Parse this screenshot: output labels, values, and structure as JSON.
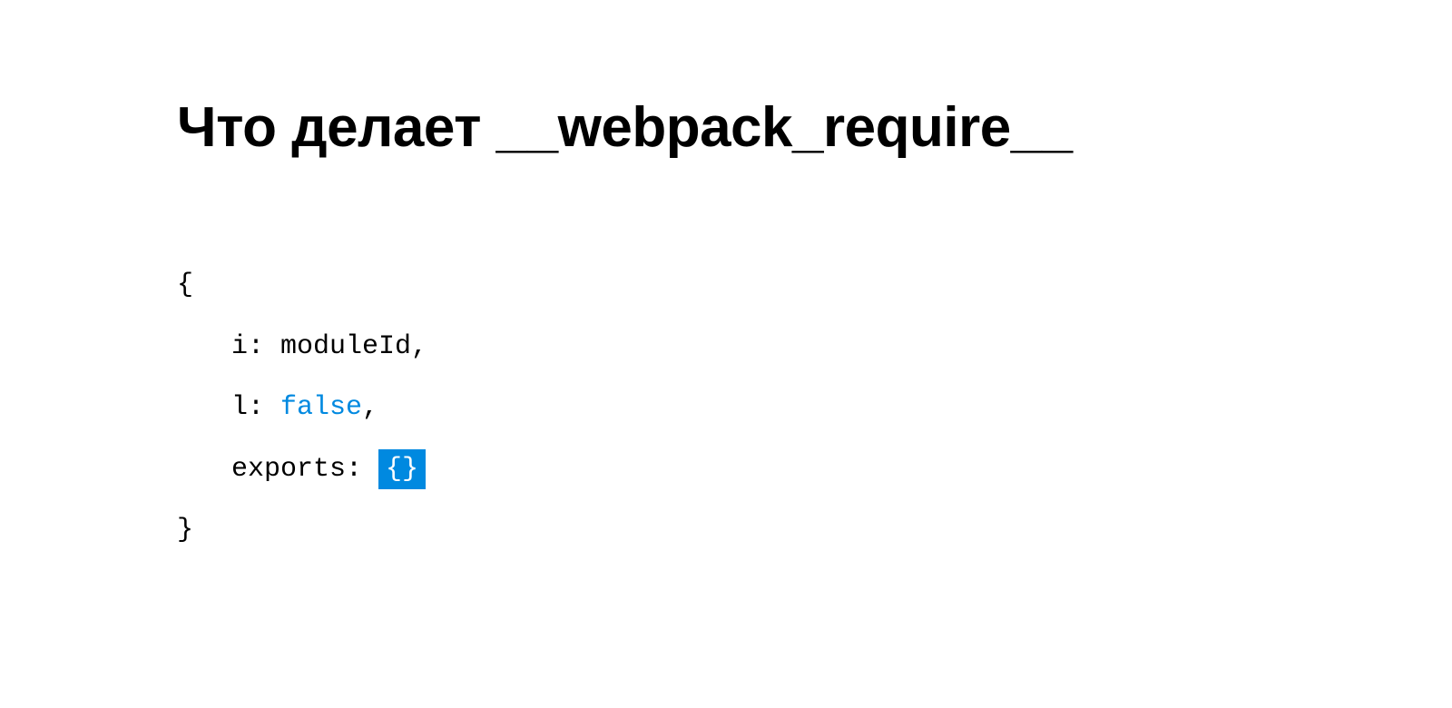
{
  "title": "Что делает __webpack_require__",
  "code": {
    "open_brace": "{",
    "line1_key": "i: ",
    "line1_value": "moduleId",
    "line1_comma": ",",
    "line2_key": "l: ",
    "line2_value": "false",
    "line2_comma": ",",
    "line3_key": "exports: ",
    "line3_value": "{}",
    "close_brace": "}"
  }
}
